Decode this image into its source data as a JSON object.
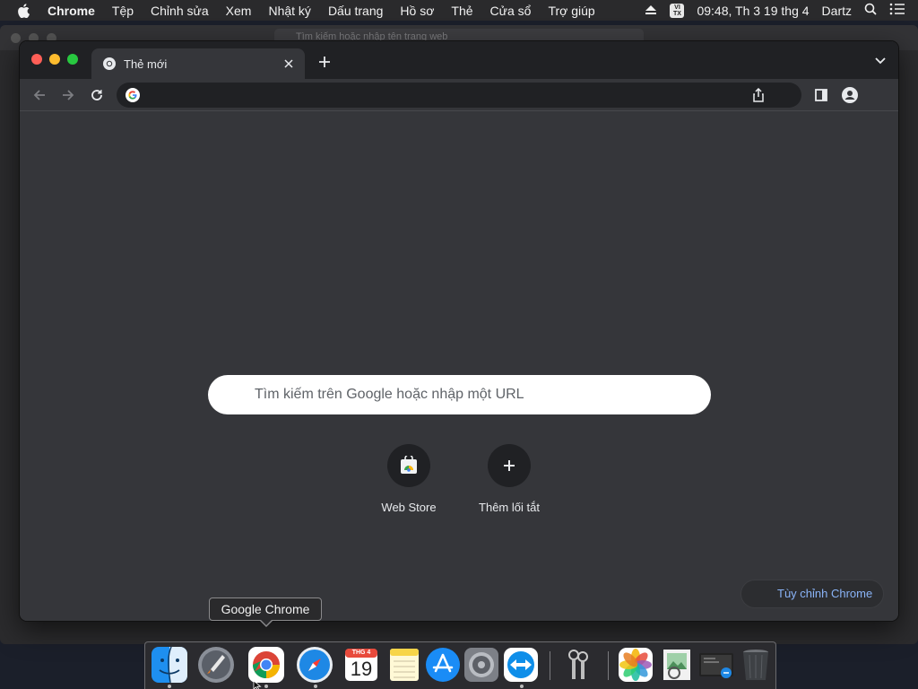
{
  "menubar": {
    "app_name": "Chrome",
    "items": [
      "Tệp",
      "Chỉnh sửa",
      "Xem",
      "Nhật ký",
      "Dấu trang",
      "Hồ sơ",
      "Thẻ",
      "Cửa sổ",
      "Trợ giúp"
    ],
    "input_source_top": "VI",
    "input_source_bottom": "TX",
    "clock": "09:48, Th 3 19 thg 4",
    "user": "Dartz"
  },
  "background_window": {
    "search_placeholder": "Tìm kiếm hoặc nhập tên trang web"
  },
  "browser": {
    "tab_title": "Thẻ mới",
    "omnibox_value": "",
    "search_placeholder": "Tìm kiếm trên Google hoặc nhập một URL",
    "shortcuts": [
      {
        "label": "Web Store",
        "icon": "web-store-icon"
      },
      {
        "label": "Thêm lối tắt",
        "icon": "plus-icon"
      }
    ],
    "customize_label": "Tùy chỉnh Chrome"
  },
  "tooltip": {
    "text": "Google Chrome"
  },
  "dock": {
    "calendar_month": "THG 4",
    "calendar_day": "19",
    "items": [
      "Finder",
      "Launchpad",
      "Google Chrome",
      "Safari",
      "Calendar",
      "Notes",
      "App Store",
      "System Preferences",
      "TeamViewer",
      "Keychain Access",
      "Photos",
      "Preview",
      "Screenshot",
      "Trash"
    ]
  },
  "colors": {
    "accent": "#8ab4f8",
    "close_red": "#ff5f57",
    "minimize_yellow": "#febc2e",
    "zoom_green": "#28c840"
  }
}
